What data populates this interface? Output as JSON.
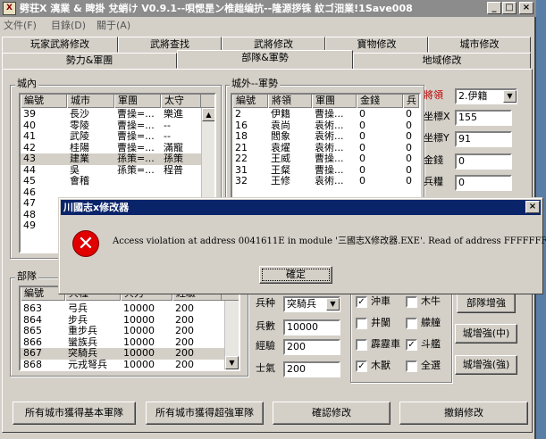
{
  "window": {
    "title": "劈荘X 漓業 & 睥掛 兌蛸け V0.9.1--唄愢昰ン椎趉编抗--隆源拶铢 紋ゴ沺業!1Save008",
    "app_icon": "X",
    "minimize": "_",
    "maximize": "□",
    "close": "×"
  },
  "menu": [
    "文件(F)",
    "目錄(D)",
    "關于(A)"
  ],
  "tabs_row1": [
    "玩家武將修改",
    "武將查找",
    "武將修改",
    "寶物修改",
    "城市修改"
  ],
  "tabs_row2": [
    "勢力&軍團",
    "部隊&軍勢",
    "地域修改"
  ],
  "city_group": {
    "label": "城內",
    "headers": [
      "編號",
      "城市",
      "軍團",
      "太守"
    ],
    "rows": [
      [
        "39",
        "長沙",
        "曹操=...",
        "樂進"
      ],
      [
        "40",
        "零陵",
        "曹操=...",
        "--"
      ],
      [
        "41",
        "武陵",
        "曹操=...",
        "--"
      ],
      [
        "42",
        "桂陽",
        "曹操=...",
        "滿寵"
      ],
      [
        "43",
        "建業",
        "孫策=...",
        "孫策"
      ],
      [
        "44",
        "吳",
        "孫策=...",
        "程普"
      ],
      [
        "45",
        "會稽",
        "",
        ""
      ],
      [
        "46",
        "",
        "",
        ""
      ],
      [
        "47",
        "",
        "",
        ""
      ],
      [
        "48",
        "",
        "",
        ""
      ],
      [
        "49",
        "",
        "",
        ""
      ]
    ],
    "selected_index": 4
  },
  "outside_group": {
    "label": "城外--軍勢",
    "headers": [
      "編號",
      "將領",
      "軍團",
      "金錢",
      "兵"
    ],
    "rows": [
      [
        "2",
        "伊籍",
        "曹操...",
        "0",
        "0"
      ],
      [
        "16",
        "袁尚",
        "袁術...",
        "0",
        "0"
      ],
      [
        "18",
        "閻象",
        "袁術...",
        "0",
        "0"
      ],
      [
        "21",
        "袁燿",
        "袁術...",
        "0",
        "0"
      ],
      [
        "22",
        "王威",
        "曹操...",
        "0",
        "0"
      ],
      [
        "31",
        "王粲",
        "曹操...",
        "0",
        "0"
      ],
      [
        "32",
        "王修",
        "袁術...",
        "0",
        "0"
      ]
    ]
  },
  "general_fields": {
    "general_label": "將領",
    "general_value": "2.伊籍",
    "x_label": "坐標X",
    "x_value": "155",
    "y_label": "坐標Y",
    "y_value": "91",
    "gold_label": "金錢",
    "gold_value": "0",
    "food_label": "兵糧",
    "food_value": "0"
  },
  "troop_group": {
    "label": "部隊",
    "headers": [
      "編號",
      "兵種",
      "兵力",
      "經驗"
    ],
    "rows": [
      [
        "863",
        "弓兵",
        "10000",
        "200"
      ],
      [
        "864",
        "步兵",
        "10000",
        "200"
      ],
      [
        "865",
        "重步兵",
        "10000",
        "200"
      ],
      [
        "866",
        "蠻族兵",
        "10000",
        "200"
      ],
      [
        "867",
        "突騎兵",
        "10000",
        "200"
      ],
      [
        "868",
        "元戎弩兵",
        "10000",
        "200"
      ]
    ],
    "selected_index": 4
  },
  "troop_fields": {
    "type_label": "兵种",
    "type_value": "突騎兵",
    "count_label": "兵數",
    "count_value": "10000",
    "exp_label": "經驗",
    "exp_value": "200",
    "morale_label": "士氣",
    "morale_value": "200"
  },
  "weapons": [
    {
      "label": "沖車",
      "checked": true
    },
    {
      "label": "木牛",
      "checked": false
    },
    {
      "label": "井闌",
      "checked": false
    },
    {
      "label": "艨艟",
      "checked": false
    },
    {
      "label": "霹靂車",
      "checked": false
    },
    {
      "label": "斗艦",
      "checked": true
    },
    {
      "label": "木獸",
      "checked": true
    },
    {
      "label": "全選",
      "checked": false
    }
  ],
  "side_buttons": [
    "部隊增強",
    "城增強(中)",
    "城增強(強)"
  ],
  "bottom_buttons": [
    "所有城市獲得基本軍隊",
    "所有城市獲得超強軍隊",
    "確認修改",
    "撤銷修改"
  ],
  "dialog": {
    "title": "川國志x修改器",
    "close": "×",
    "message": "Access violation at address 0041611E in module '三國志X修改器.EXE'. Read of address FFFFFFFF.",
    "ok_label": "確定"
  }
}
